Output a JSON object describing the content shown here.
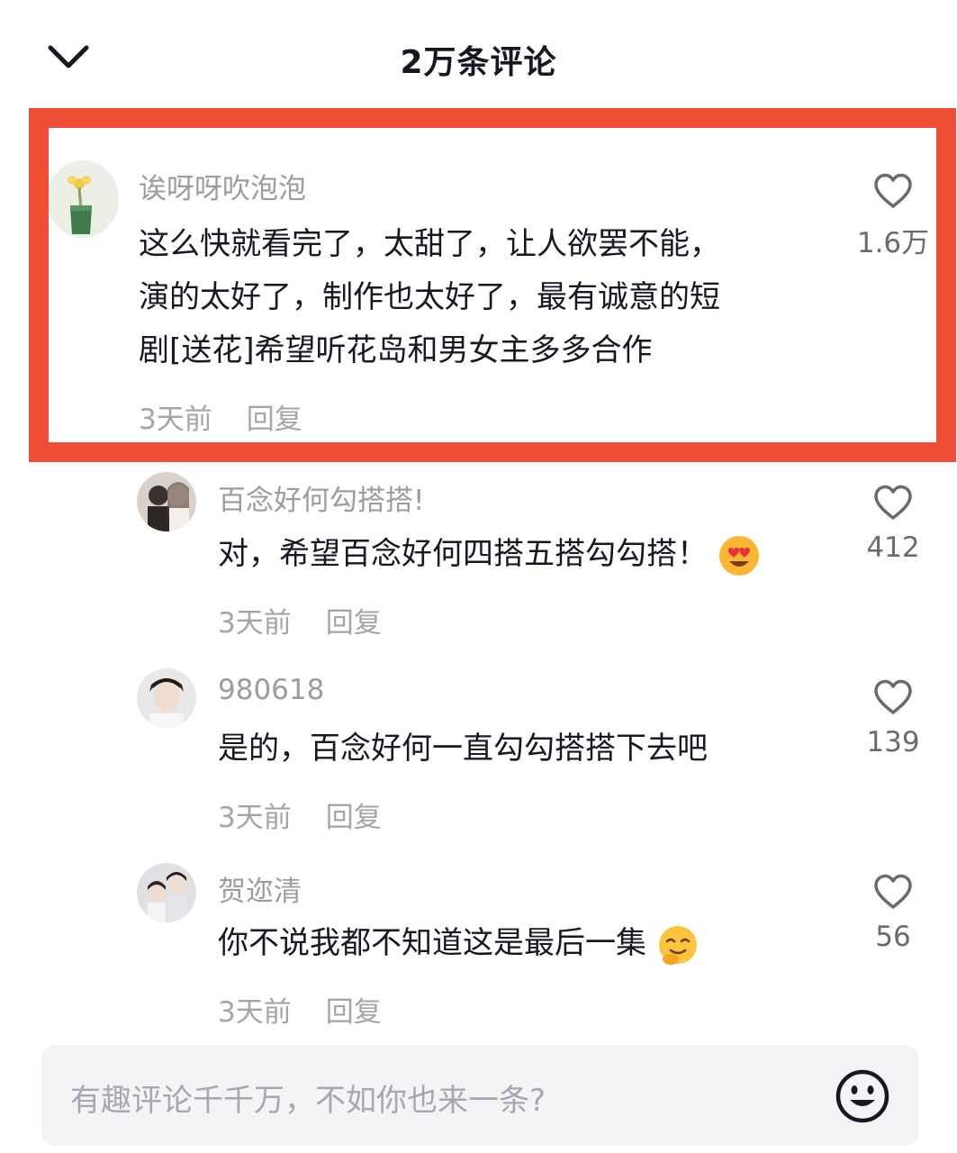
{
  "header": {
    "title": "2万条评论",
    "back_icon": "chevron-down-icon"
  },
  "comments": [
    {
      "username": "诶呀呀吹泡泡",
      "lines": [
        "这么快就看完了，太甜了，让人欲罢不能，",
        "演的太好了，制作也太好了，最有诚意的短",
        "剧[送花]希望听花岛和男女主多多合作"
      ],
      "time": "3天前",
      "reply": "回复",
      "likes": "1.6万"
    },
    {
      "username": "百念好何勾搭搭!",
      "lines": [
        "对，希望百念好何四搭五搭勾勾搭！"
      ],
      "emoji": "heart-eyes-emoji",
      "time": "3天前",
      "reply": "回复",
      "likes": "412"
    },
    {
      "username": "980618",
      "lines": [
        "是的，百念好何一直勾勾搭搭下去吧"
      ],
      "time": "3天前",
      "reply": "回复",
      "likes": "139"
    },
    {
      "username": "贺迩清",
      "lines": [
        "你不说我都不知道这是最后一集"
      ],
      "emoji": "shy-smile-emoji",
      "time": "3天前",
      "reply": "回复",
      "likes": "56"
    }
  ],
  "input": {
    "placeholder": "有趣评论千千万，不如你也来一条?",
    "emoji_icon": "smiley-icon"
  },
  "colors": {
    "highlight": "#ee4e35",
    "meta": "#a4a5a9",
    "text": "#161823"
  }
}
